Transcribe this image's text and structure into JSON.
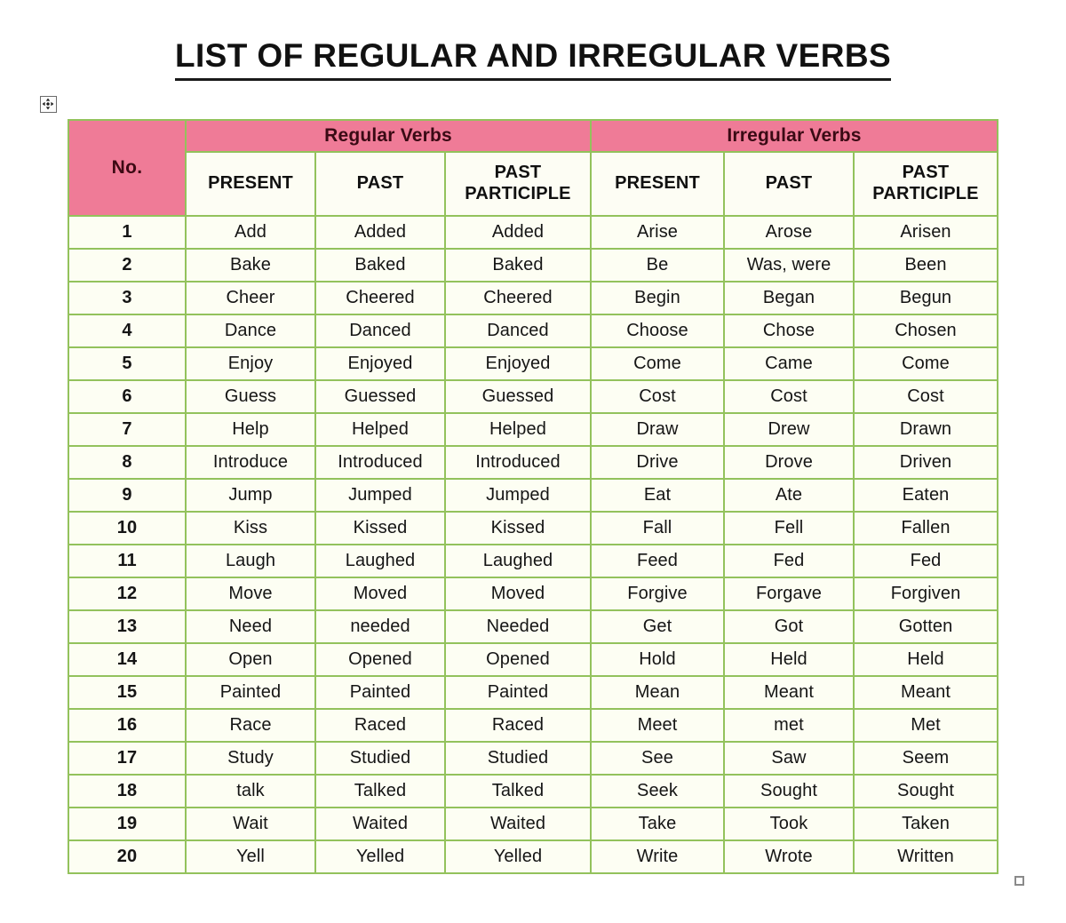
{
  "document": {
    "title": "LIST OF REGULAR AND IRREGULAR VERBS"
  },
  "handles": {
    "move_handle_name": "table-move-handle",
    "resize_handle_name": "table-resize-handle"
  },
  "colors": {
    "header_pink": "#EF7B97",
    "border_green": "#93C25C",
    "cell_cream": "#FDFEF3",
    "header_text": "#3A0A14",
    "body_text": "#151515"
  },
  "table": {
    "no_header": "No.",
    "groups": [
      {
        "label": "Regular Verbs"
      },
      {
        "label": "Irregular Verbs"
      }
    ],
    "sub_headers": {
      "present": "PRESENT",
      "past": "PAST",
      "past_participle_line1": "PAST",
      "past_participle_line2": "PARTICIPLE"
    },
    "rows": [
      {
        "no": "1",
        "r_present": "Add",
        "r_past": "Added",
        "r_pp": "Added",
        "i_present": "Arise",
        "i_past": "Arose",
        "i_pp": "Arisen"
      },
      {
        "no": "2",
        "r_present": "Bake",
        "r_past": "Baked",
        "r_pp": "Baked",
        "i_present": "Be",
        "i_past": "Was, were",
        "i_pp": "Been"
      },
      {
        "no": "3",
        "r_present": "Cheer",
        "r_past": "Cheered",
        "r_pp": "Cheered",
        "i_present": "Begin",
        "i_past": "Began",
        "i_pp": "Begun"
      },
      {
        "no": "4",
        "r_present": "Dance",
        "r_past": "Danced",
        "r_pp": "Danced",
        "i_present": "Choose",
        "i_past": "Chose",
        "i_pp": "Chosen"
      },
      {
        "no": "5",
        "r_present": "Enjoy",
        "r_past": "Enjoyed",
        "r_pp": "Enjoyed",
        "i_present": "Come",
        "i_past": "Came",
        "i_pp": "Come"
      },
      {
        "no": "6",
        "r_present": "Guess",
        "r_past": "Guessed",
        "r_pp": "Guessed",
        "i_present": "Cost",
        "i_past": "Cost",
        "i_pp": "Cost"
      },
      {
        "no": "7",
        "r_present": "Help",
        "r_past": "Helped",
        "r_pp": "Helped",
        "i_present": "Draw",
        "i_past": "Drew",
        "i_pp": "Drawn"
      },
      {
        "no": "8",
        "r_present": "Introduce",
        "r_past": "Introduced",
        "r_pp": "Introduced",
        "i_present": "Drive",
        "i_past": "Drove",
        "i_pp": "Driven"
      },
      {
        "no": "9",
        "r_present": "Jump",
        "r_past": "Jumped",
        "r_pp": "Jumped",
        "i_present": "Eat",
        "i_past": "Ate",
        "i_pp": "Eaten"
      },
      {
        "no": "10",
        "r_present": "Kiss",
        "r_past": "Kissed",
        "r_pp": "Kissed",
        "i_present": "Fall",
        "i_past": "Fell",
        "i_pp": "Fallen"
      },
      {
        "no": "11",
        "r_present": "Laugh",
        "r_past": "Laughed",
        "r_pp": "Laughed",
        "i_present": "Feed",
        "i_past": "Fed",
        "i_pp": "Fed"
      },
      {
        "no": "12",
        "r_present": "Move",
        "r_past": "Moved",
        "r_pp": "Moved",
        "i_present": "Forgive",
        "i_past": "Forgave",
        "i_pp": "Forgiven"
      },
      {
        "no": "13",
        "r_present": "Need",
        "r_past": "needed",
        "r_pp": "Needed",
        "i_present": "Get",
        "i_past": "Got",
        "i_pp": "Gotten"
      },
      {
        "no": "14",
        "r_present": "Open",
        "r_past": "Opened",
        "r_pp": "Opened",
        "i_present": "Hold",
        "i_past": "Held",
        "i_pp": "Held"
      },
      {
        "no": "15",
        "r_present": "Painted",
        "r_past": "Painted",
        "r_pp": "Painted",
        "i_present": "Mean",
        "i_past": "Meant",
        "i_pp": "Meant"
      },
      {
        "no": "16",
        "r_present": "Race",
        "r_past": "Raced",
        "r_pp": "Raced",
        "i_present": "Meet",
        "i_past": "met",
        "i_pp": "Met"
      },
      {
        "no": "17",
        "r_present": "Study",
        "r_past": "Studied",
        "r_pp": "Studied",
        "i_present": "See",
        "i_past": "Saw",
        "i_pp": "Seem"
      },
      {
        "no": "18",
        "r_present": "talk",
        "r_past": "Talked",
        "r_pp": "Talked",
        "i_present": "Seek",
        "i_past": "Sought",
        "i_pp": "Sought"
      },
      {
        "no": "19",
        "r_present": "Wait",
        "r_past": "Waited",
        "r_pp": "Waited",
        "i_present": "Take",
        "i_past": "Took",
        "i_pp": "Taken"
      },
      {
        "no": "20",
        "r_present": "Yell",
        "r_past": "Yelled",
        "r_pp": "Yelled",
        "i_present": "Write",
        "i_past": "Wrote",
        "i_pp": "Written"
      }
    ]
  }
}
